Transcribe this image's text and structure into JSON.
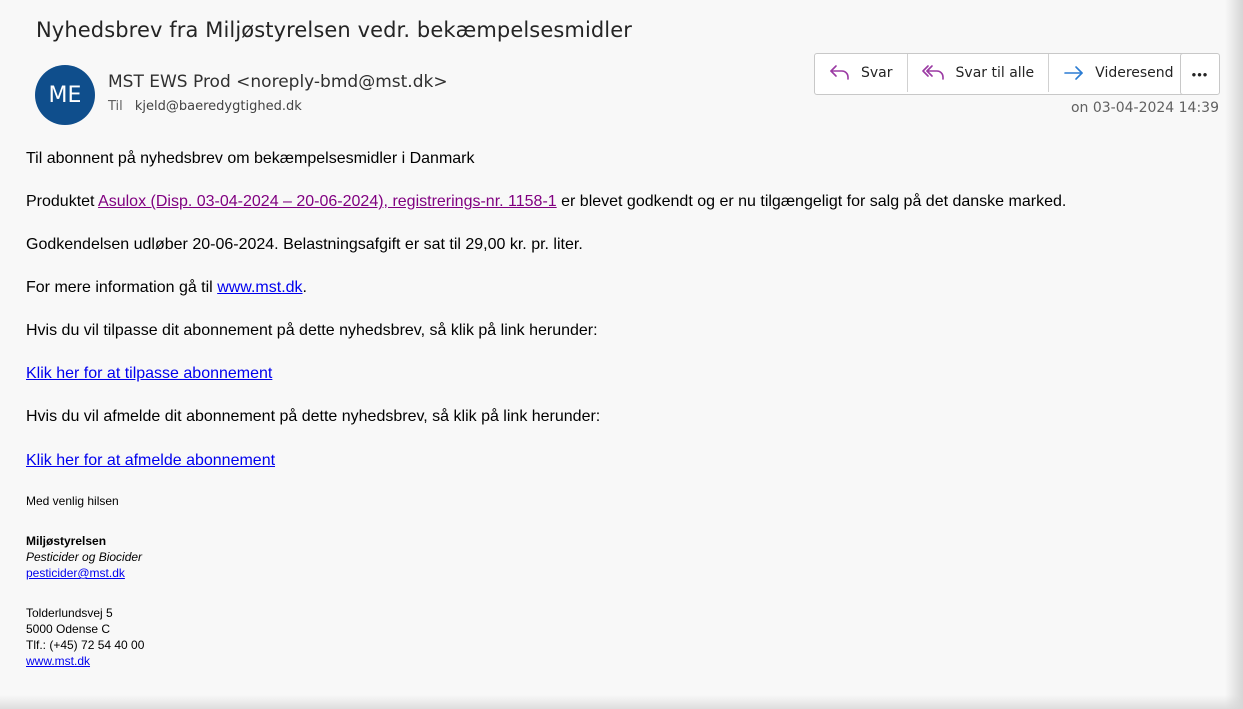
{
  "email": {
    "subject": "Nyhedsbrev fra Miljøstyrelsen vedr. bekæmpelsesmidler",
    "avatar_initials": "ME",
    "avatar_color": "#0f4e8c",
    "sender": "MST EWS Prod <noreply-bmd@mst.dk>",
    "to_label": "Til",
    "to_address": "kjeld@baeredygtighed.dk",
    "date": "on 03-04-2024 14:39"
  },
  "actions": {
    "reply": "Svar",
    "reply_all": "Svar til alle",
    "forward": "Videresend",
    "more": "•••"
  },
  "body": {
    "p1": "Til abonnent på nyhedsbrev om bekæmpelsesmidler i Danmark",
    "p2_before": "Produktet ",
    "p2_link": "Asulox (Disp. 03-04-2024 – 20-06-2024), registrerings-nr. 1158-1",
    "p2_after": " er blevet godkendt og er nu tilgængeligt for salg på det danske marked.",
    "p3": "Godkendelsen udløber 20-06-2024. Belastningsafgift er sat til 29,00 kr. pr. liter.",
    "p4_before": "For mere information gå til ",
    "p4_link": "www.mst.dk",
    "p4_after": ".",
    "p5": "Hvis du vil tilpasse dit abonnement på dette nyhedsbrev, så klik på link herunder:",
    "p6_link": "Klik her for at tilpasse abonnement",
    "p7": "Hvis du vil afmelde dit abonnement på dette nyhedsbrev, så klik på link herunder:",
    "p8_link": "Klik her for at afmelde abonnement"
  },
  "signature": {
    "greeting": "Med venlig hilsen",
    "org": "Miljøstyrelsen",
    "dept": "Pesticider og Biocider",
    "email": "pesticider@mst.dk",
    "street": "Tolderlundsvej 5",
    "city": "5000 Odense C",
    "phone": "Tlf.: (+45) 72 54 40 00",
    "web": "www.mst.dk"
  }
}
